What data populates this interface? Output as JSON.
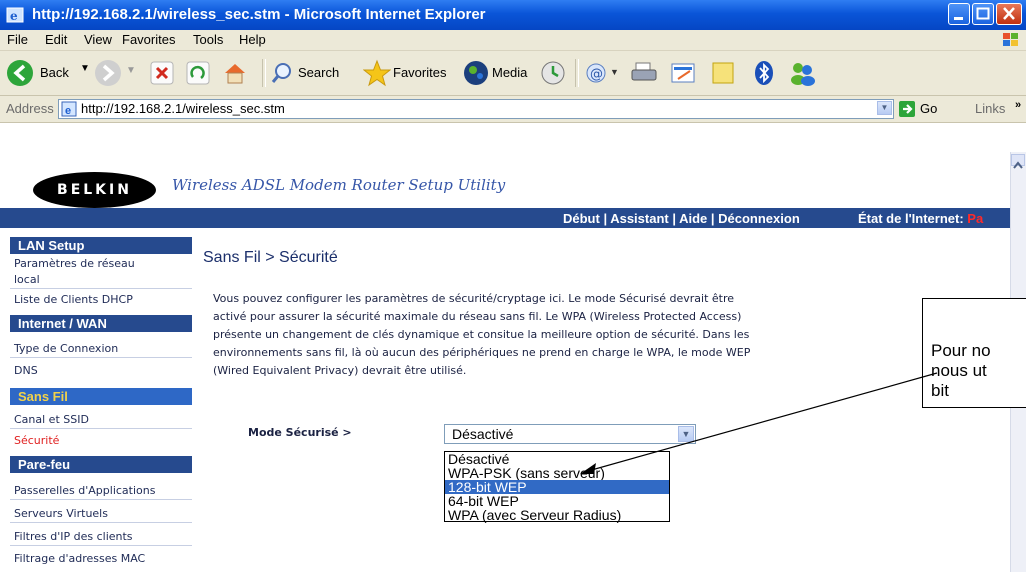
{
  "window": {
    "title": "http://192.168.2.1/wireless_sec.stm - Microsoft Internet Explorer"
  },
  "menu": [
    "File",
    "Edit",
    "View",
    "Favorites",
    "Tools",
    "Help"
  ],
  "toolbar": {
    "back": "Back",
    "search": "Search",
    "favorites": "Favorites",
    "media": "Media"
  },
  "address": {
    "label": "Address",
    "url": "http://192.168.2.1/wireless_sec.stm",
    "go": "Go",
    "links": "Links"
  },
  "header": {
    "logo": "BELKIN",
    "tagline": "Wireless ADSL Modem Router Setup Utility",
    "nav_links": "Début | Assistant | Aide | Déconnexion",
    "internet_status_label": "État de l'Internet:",
    "internet_status_value": "Pa"
  },
  "sidebar": {
    "lan_setup": "LAN Setup",
    "lan_item1a": "Paramètres de réseau",
    "lan_item1b": "local",
    "lan_item2": "Liste de Clients DHCP",
    "internet_wan": "Internet / WAN",
    "wan_item1": "Type de Connexion",
    "wan_item2": "DNS",
    "sans_fil": "Sans Fil",
    "sf_item1": "Canal et SSID",
    "sf_item2": "Sécurité",
    "pare_feu": "Pare-feu",
    "pf_item1": "Passerelles d'Applications",
    "pf_item2": "Serveurs Virtuels",
    "pf_item3": "Filtres d'IP des clients",
    "pf_item4": "Filtrage d'adresses MAC"
  },
  "main": {
    "heading": "Sans Fil > Sécurité",
    "description": [
      "Vous pouvez configurer les paramètres de sécurité/cryptage ici. Le mode Sécurisé devrait être",
      "activé pour assurer la sécurité maximale du réseau sans fil. Le WPA (Wireless Protected Access)",
      "présente un changement de clés dynamique et consitue la meilleure option de sécurité. Dans les",
      "environnements sans fil, là où aucun des périphériques ne prend en charge le WPA, le mode WEP",
      "(Wired Equivalent Privacy) devrait être utilisé."
    ],
    "mode_label": "Mode Sécurisé >",
    "select_value": "Désactivé",
    "options": [
      "Désactivé",
      "WPA-PSK (sans serveur)",
      "128-bit WEP",
      "64-bit WEP",
      "WPA (avec Serveur Radius)"
    ],
    "highlighted_option": "128-bit WEP"
  },
  "callout": {
    "lines": [
      "Pour no",
      "nous ut",
      "bit"
    ]
  },
  "colors": {
    "titlebar": "#0a55d8",
    "nav_blue": "#264a8e",
    "highlight": "#316ac5",
    "alert_red": "#ff2a2a"
  }
}
